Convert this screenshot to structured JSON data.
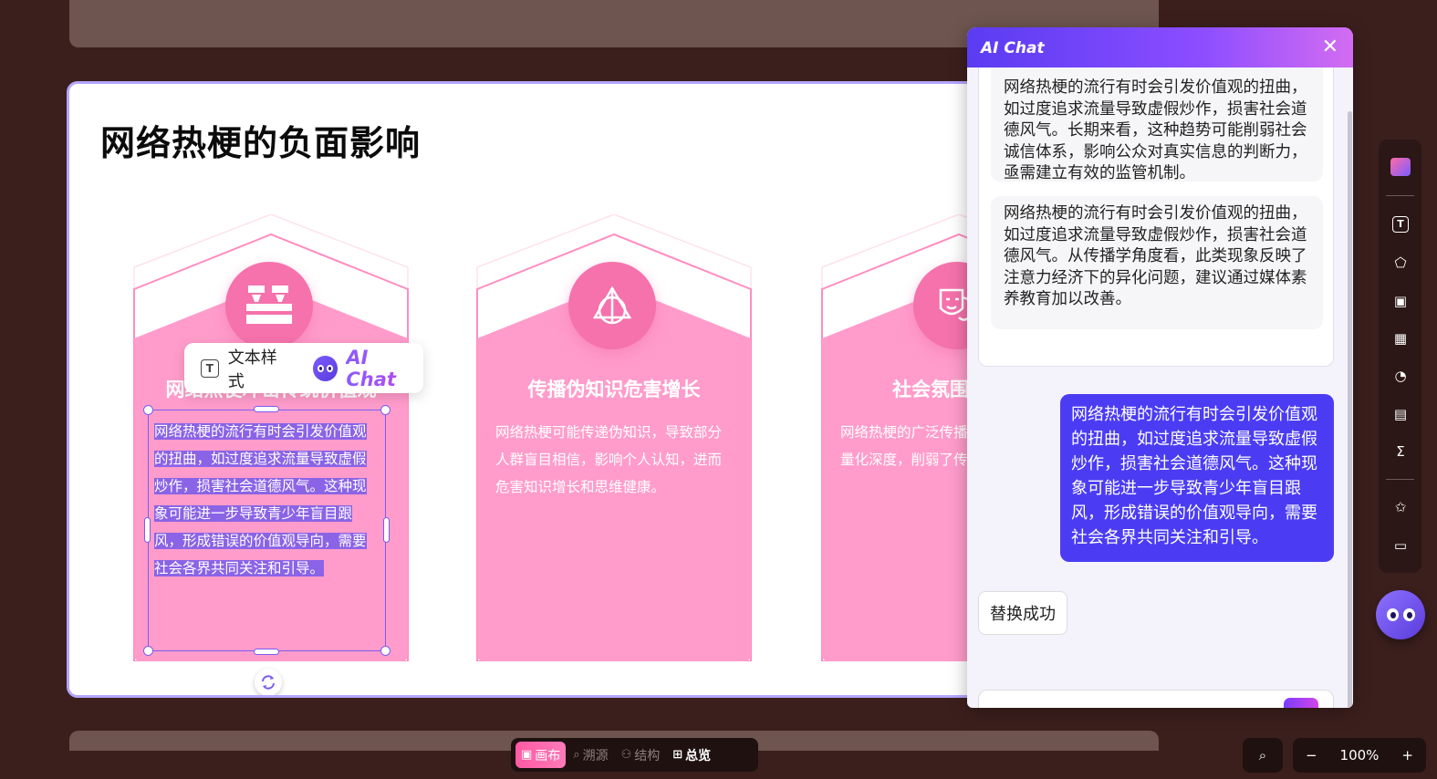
{
  "slide": {
    "title": "网络热梗的负面影响",
    "cards": [
      {
        "title": "网络热梗冲击传统价值观",
        "body": "网络热梗的流行有时会引发价值观的扭曲，如过度追求流量导致虚假炒作，损害社会道德风气。这种现象可能进一步导致青少年盲目跟风，形成错误的价值观导向，需要社会各界共同关注和引导。"
      },
      {
        "title": "传播伪知识危害增长",
        "body": "网络热梗可能传递伪知识，导致部分人群盲目相信，影响个人认知，进而危害知识增长和思维健康。"
      },
      {
        "title": "社会氛围网络",
        "body": "网络热梗的广泛传播趋于网络化、轻量化深度，削弱了传统文蕴。"
      }
    ]
  },
  "selected_text_lines": [
    "网络热梗的流行有时会引发价值观",
    "的扭曲，如过度追求流量导致虚假",
    "炒作，损害社会道德风气。这种现",
    "象可能进一步导致青少年盲目跟",
    "风，形成错误的价值观导向，需要",
    "社会各界共同关注和引导。"
  ],
  "mini_toolbar": {
    "text_style": "文本样式",
    "ai_chat": "AI Chat"
  },
  "chat": {
    "title": "AI Chat",
    "messages": [
      {
        "role": "ai",
        "text": "网络热梗的流行有时会引发价值观的扭曲，如过度追求流量导致虚假炒作，损害社会道德风气。长期来看，这种趋势可能削弱社会诚信体系，影响公众对真实信息的判断力，亟需建立有效的监管机制。"
      },
      {
        "role": "ai",
        "text": "网络热梗的流行有时会引发价值观的扭曲，如过度追求流量导致虚假炒作，损害社会道德风气。从传播学角度看，此类现象反映了注意力经济下的异化问题，建议通过媒体素养教育加以改善。"
      },
      {
        "role": "user",
        "text": "网络热梗的流行有时会引发价值观的扭曲，如过度追求流量导致虚假炒作，损害社会道德风气。这种现象可能进一步导致青少年盲目跟风，形成错误的价值观导向，需要社会各界共同关注和引导。"
      },
      {
        "role": "status",
        "text": "替换成功"
      }
    ]
  },
  "modes": [
    {
      "label": "画布",
      "icon": "canvas-icon",
      "active": true
    },
    {
      "label": "溯源",
      "icon": "trace-icon"
    },
    {
      "label": "结构",
      "icon": "structure-icon"
    },
    {
      "label": "总览",
      "icon": "overview-icon"
    }
  ],
  "zoom": {
    "value": "100%",
    "minus": "−",
    "plus": "+"
  },
  "rail_tools": [
    "text-icon",
    "shape-icon",
    "image-icon",
    "table-icon",
    "chart-icon",
    "media-icon",
    "formula-icon",
    "effects-icon",
    "template-icon"
  ],
  "colors": {
    "accent_pink": "#f572ac",
    "card_pink": "#ff9ccb",
    "chat_purple": "#4b3cf4"
  }
}
